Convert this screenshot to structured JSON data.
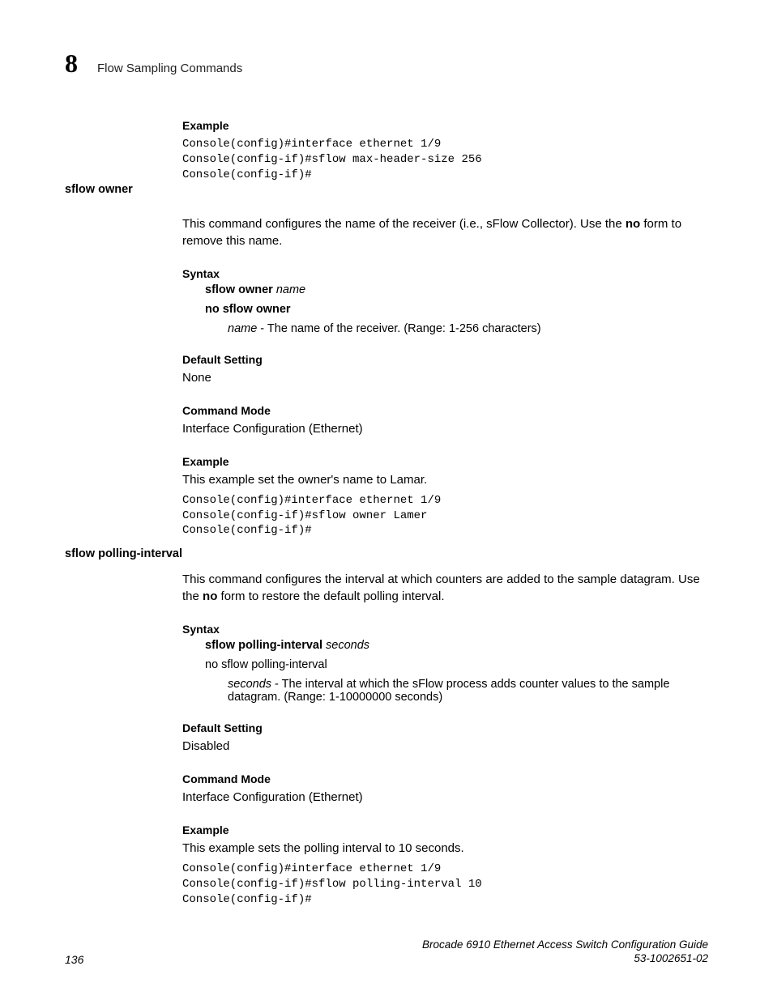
{
  "header": {
    "chapter": "8",
    "title": "Flow Sampling Commands"
  },
  "top_example": {
    "label": "Example",
    "code": "Console(config)#interface ethernet 1/9\nConsole(config-if)#sflow max-header-size 256\nConsole(config-if)#"
  },
  "owner": {
    "sidebar": "sflow owner",
    "desc_part1": "This command configures the name of the receiver (i.e., sFlow Collector). Use the ",
    "desc_bold": "no",
    "desc_part2": " form to remove this name.",
    "syntax_label": "Syntax",
    "syntax_cmd_bold": "sflow owner",
    "syntax_cmd_italic": " name",
    "syntax_no": "no sflow owner",
    "param_italic": "name",
    "param_desc": " - The name of the receiver. (Range: 1-256 characters)",
    "default_label": "Default Setting",
    "default_value": "None",
    "mode_label": "Command Mode",
    "mode_value": "Interface Configuration (Ethernet)",
    "example_label": "Example",
    "example_desc": "This example set the owner's name to Lamar.",
    "example_code": "Console(config)#interface ethernet 1/9\nConsole(config-if)#sflow owner Lamer\nConsole(config-if)#"
  },
  "polling": {
    "sidebar": "sflow polling-interval",
    "desc_part1": "This command configures the interval at which counters are added to the sample datagram. Use the ",
    "desc_bold": "no",
    "desc_part2": " form to restore the default polling interval.",
    "syntax_label": "Syntax",
    "syntax_cmd_bold": "sflow polling-interval",
    "syntax_cmd_italic": " seconds",
    "syntax_no": "no sflow polling-interval",
    "param_italic": "seconds",
    "param_desc": " - The interval at which the sFlow process adds counter values to the sample datagram. (Range: 1-10000000 seconds)",
    "default_label": "Default Setting",
    "default_value": "Disabled",
    "mode_label": "Command Mode",
    "mode_value": "Interface Configuration (Ethernet)",
    "example_label": "Example",
    "example_desc": "This example sets the polling interval to 10 seconds.",
    "example_code": "Console(config)#interface ethernet 1/9\nConsole(config-if)#sflow polling-interval 10\nConsole(config-if)#"
  },
  "footer": {
    "page": "136",
    "doc_title": "Brocade 6910 Ethernet Access Switch Configuration Guide",
    "doc_id": "53-1002651-02"
  }
}
